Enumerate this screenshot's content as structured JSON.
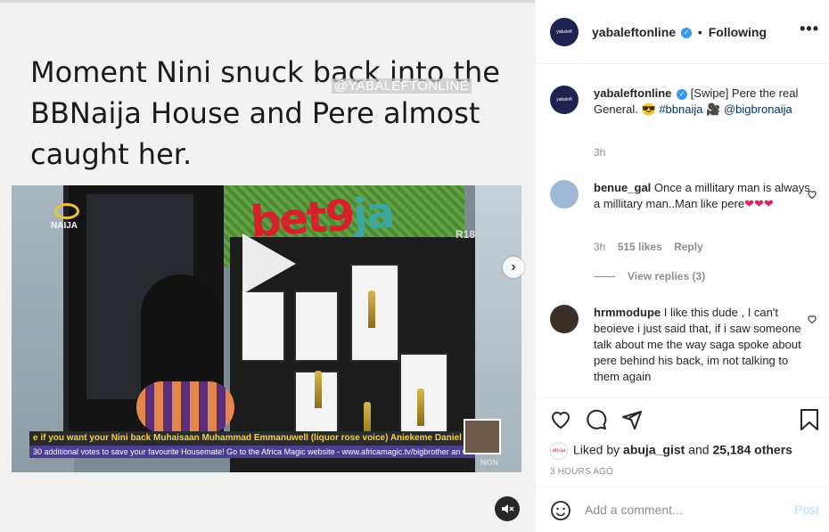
{
  "media": {
    "headline": "Moment Nini snuck back into the BBNaija House and Pere almost caught her.",
    "watermark": "@YABALEFTONLINE",
    "video": {
      "brand_logo": "bet9ja",
      "rating": "R18",
      "corner_logo": "BIGBROTHER NAIJA",
      "ticker_top": "e if you want your Nini back   Muhaisaan Muhammad   Emmanuwell (liquor rose voice)   Aniekeme Daniel I can't k",
      "ticker_bottom": "30 additional votes to save your favourite Housemate!   Go to the Africa Magic website - www.africamagic.tv/bigbrother an w",
      "channel": "NON"
    },
    "icons": {
      "play": "play-icon",
      "next": "chevron-right-icon",
      "mute": "volume-muted-icon"
    }
  },
  "header": {
    "avatar_text": "yabaleft",
    "username": "yabaleftonline",
    "separator": "•",
    "follow_label": "Following",
    "more_label": "•••"
  },
  "caption": {
    "avatar_text": "yabaleft",
    "username": "yabaleftonline",
    "text_1": "[Swipe] Pere the real General.",
    "emoji_1": "😎",
    "hashtag": "#bbnaija",
    "emoji_2": "🎥",
    "mention": "@bigbronaija",
    "time": "3h"
  },
  "comments": [
    {
      "username": "benue_gal",
      "text": "Once a millitary man is always a millitary man..Man like pere",
      "hearts": "❤❤❤",
      "time": "3h",
      "likes": "515 likes",
      "reply_label": "Reply",
      "view_replies": "View replies (3)"
    },
    {
      "username": "hrmmodupe",
      "text": "I like this dude , I can't beoieve i just said that, if i saw someone talk about me the way saga spoke about pere behind his back, im not talking to them again"
    }
  ],
  "actions": {
    "icons": [
      "heart-icon",
      "comment-icon",
      "share-icon",
      "bookmark-icon"
    ],
    "liked_prefix": "Liked by",
    "liked_user": "abuja_gist",
    "liked_and": "and",
    "liked_others": "25,184 others",
    "liked_avatar_text": "abuja",
    "ago": "3 HOURS AGO"
  },
  "add_comment": {
    "placeholder": "Add a comment...",
    "post_label": "Post"
  },
  "colors": {
    "link": "#00376b",
    "verified": "#3897f0",
    "post_disabled": "#b2dffc",
    "heart": "#e0245e"
  }
}
